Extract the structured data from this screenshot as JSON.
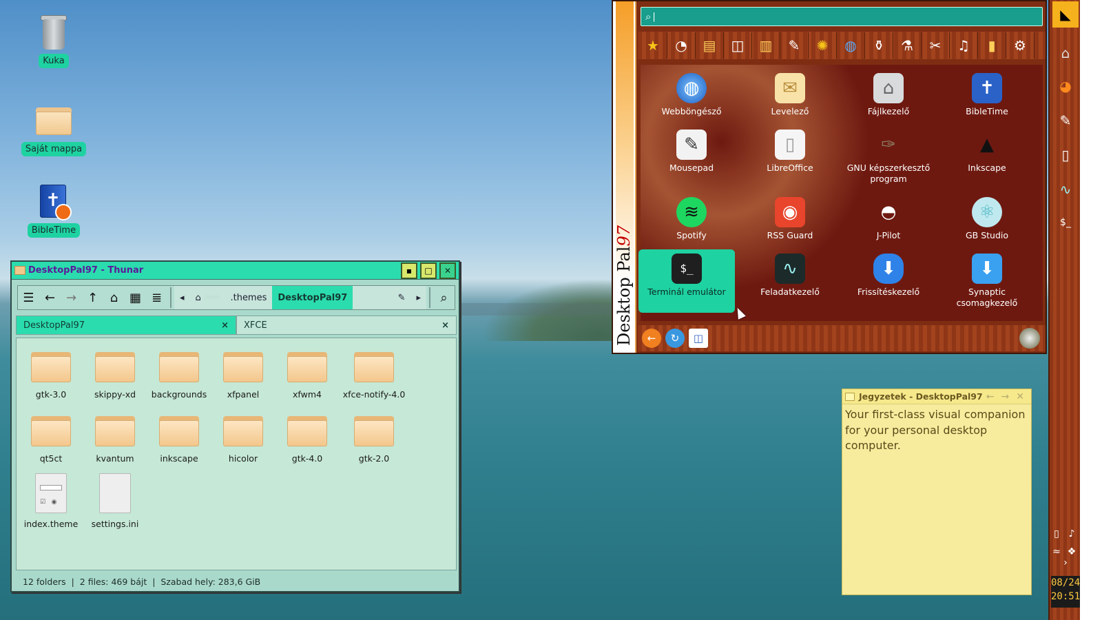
{
  "desktop": {
    "icons": [
      {
        "label": "Kuka",
        "icon": "trash-icon"
      },
      {
        "label": "Saját mappa",
        "icon": "home-folder-icon"
      },
      {
        "label": "BibleTime",
        "icon": "bibletime-icon"
      }
    ]
  },
  "thunar": {
    "title": "DesktopPal97 - Thunar",
    "path": {
      "hidden_user": "·····",
      "segment1": ".themes",
      "segment2": "DesktopPal97"
    },
    "tabs": [
      {
        "label": "DesktopPal97",
        "close": "×"
      },
      {
        "label": "XFCE",
        "close": "×"
      }
    ],
    "files": [
      {
        "name": "gtk-3.0",
        "type": "folder"
      },
      {
        "name": "skippy-xd",
        "type": "folder"
      },
      {
        "name": "backgrounds",
        "type": "folder"
      },
      {
        "name": "xfpanel",
        "type": "folder"
      },
      {
        "name": "xfwm4",
        "type": "folder"
      },
      {
        "name": "xfce-notify-4.0",
        "type": "folder"
      },
      {
        "name": "qt5ct",
        "type": "folder"
      },
      {
        "name": "kvantum",
        "type": "folder"
      },
      {
        "name": "inkscape",
        "type": "folder"
      },
      {
        "name": "hicolor",
        "type": "folder"
      },
      {
        "name": "gtk-4.0",
        "type": "folder"
      },
      {
        "name": "gtk-2.0",
        "type": "folder"
      },
      {
        "name": "index.theme",
        "type": "theme-file"
      },
      {
        "name": "settings.ini",
        "type": "file"
      }
    ],
    "status": "12 folders  |  2 files: 469 bájt  |  Szabad hely: 283,6 GiB"
  },
  "menu": {
    "brand": "Desktop Pal",
    "brand_num": "97",
    "search_placeholder": "",
    "apps": [
      {
        "label": "Webböngésző",
        "icon": "globe-icon"
      },
      {
        "label": "Levelező",
        "icon": "mail-icon"
      },
      {
        "label": "Fájlkezelő",
        "icon": "folder-icon"
      },
      {
        "label": "BibleTime",
        "icon": "bibletime-icon"
      },
      {
        "label": "Mousepad",
        "icon": "mousepad-icon"
      },
      {
        "label": "LibreOffice",
        "icon": "document-icon"
      },
      {
        "label": "GNU képszerkesztő program",
        "icon": "gimp-icon"
      },
      {
        "label": "Inkscape",
        "icon": "inkscape-icon"
      },
      {
        "label": "Spotify",
        "icon": "spotify-icon"
      },
      {
        "label": "RSS Guard",
        "icon": "rss-icon"
      },
      {
        "label": "J-Pilot",
        "icon": "penguin-icon"
      },
      {
        "label": "GB Studio",
        "icon": "atom-icon"
      },
      {
        "label": "Terminál emulátor",
        "icon": "terminal-icon",
        "selected": true
      },
      {
        "label": "Feladatkezelő",
        "icon": "task-manager-icon"
      },
      {
        "label": "Frissítéskezelő",
        "icon": "update-icon"
      },
      {
        "label": "Synaptic csomagkezelő",
        "icon": "synaptic-icon"
      }
    ]
  },
  "panel": {
    "clock_date": "08/24",
    "clock_time": "20:51"
  },
  "notes": {
    "title": "Jegyzetek - DesktopPal97",
    "body": "Your first-class visual companion for your personal desktop computer."
  }
}
